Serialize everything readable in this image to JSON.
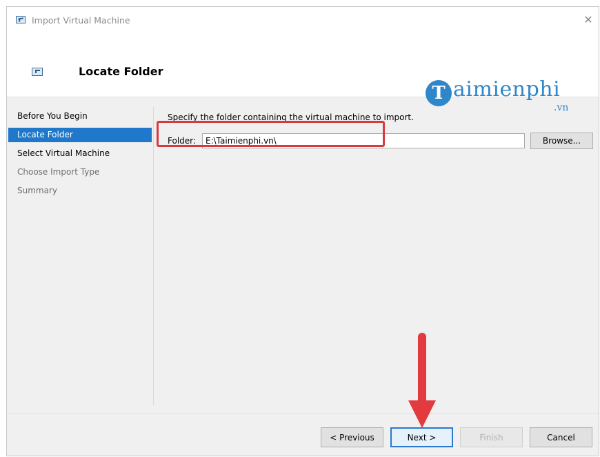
{
  "window": {
    "title": "Import Virtual Machine",
    "close_glyph": "✕",
    "icon": "vm-window-icon"
  },
  "header": {
    "title": "Locate Folder",
    "icon": "vm-folder-icon"
  },
  "watermark": {
    "logo_letter": "T",
    "text": "aimienphi",
    "suffix": ".vn"
  },
  "sidebar": {
    "items": [
      {
        "label": "Before You Begin",
        "state": "done"
      },
      {
        "label": "Locate Folder",
        "state": "active"
      },
      {
        "label": "Select Virtual Machine",
        "state": "done"
      },
      {
        "label": "Choose Import Type",
        "state": "future"
      },
      {
        "label": "Summary",
        "state": "future"
      }
    ]
  },
  "main": {
    "description": "Specify the folder containing the virtual machine to import.",
    "folder_label": "Folder:",
    "folder_value": "E:\\Taimienphi.vn\\",
    "browse_label": "Browse..."
  },
  "footer": {
    "previous_label": "< Previous",
    "next_label": "Next >",
    "finish_label": "Finish",
    "cancel_label": "Cancel"
  },
  "colors": {
    "accent": "#1f78c9",
    "annotation_red": "#e23a3f",
    "watermark_blue": "#2f86c9"
  }
}
